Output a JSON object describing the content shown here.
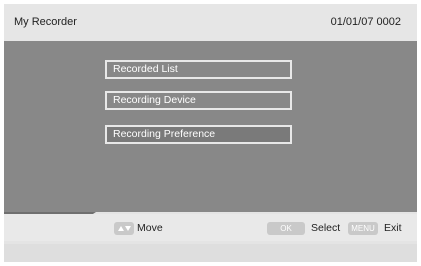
{
  "header": {
    "title": "My Recorder",
    "datetime": "01/01/07 0002"
  },
  "menu": {
    "items": [
      {
        "label": "Recorded List"
      },
      {
        "label": "Recording Device"
      },
      {
        "label": "Recording Preference"
      }
    ]
  },
  "footer": {
    "move_label": "Move",
    "ok_key": "OK",
    "select_label": "Select",
    "menu_key": "MENU",
    "exit_label": "Exit"
  }
}
